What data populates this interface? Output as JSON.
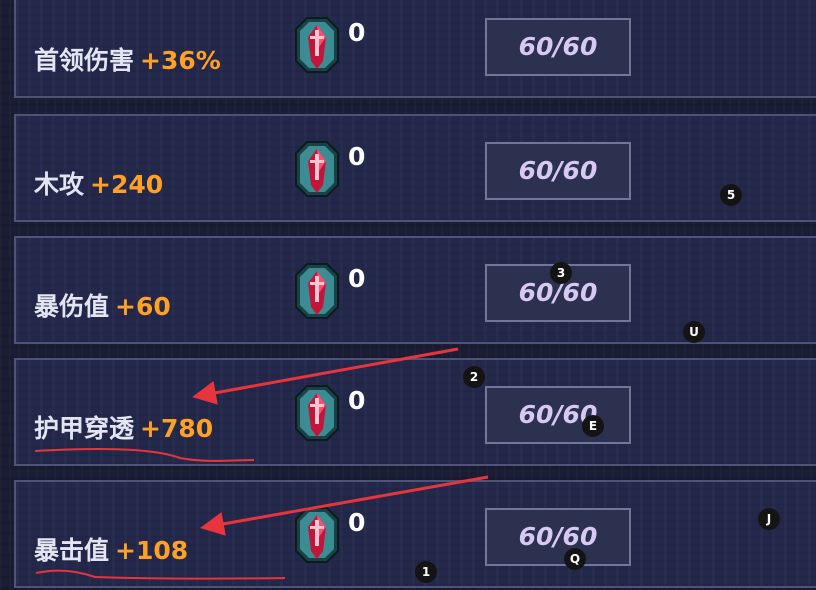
{
  "rows": [
    {
      "name": "首领伤害",
      "value": "+36%",
      "gem_count": "0",
      "progress": "60/60"
    },
    {
      "name": "木攻",
      "value": "+240",
      "gem_count": "0",
      "progress": "60/60"
    },
    {
      "name": "暴伤值",
      "value": "+60",
      "gem_count": "0",
      "progress": "60/60"
    },
    {
      "name": "护甲穿透",
      "value": "+780",
      "gem_count": "0",
      "progress": "60/60"
    },
    {
      "name": "暴击值",
      "value": "+108",
      "gem_count": "0",
      "progress": "60/60"
    }
  ],
  "gem_icon": "red-sword-gem-icon",
  "markers": [
    "5",
    "3",
    "U",
    "2",
    "E",
    "J",
    "Q",
    "1"
  ],
  "colors": {
    "stat_value": "#ffa126",
    "stat_name": "#e3e5f2",
    "progress_text": "#d7c8f4",
    "annotation": "#e8353d"
  }
}
